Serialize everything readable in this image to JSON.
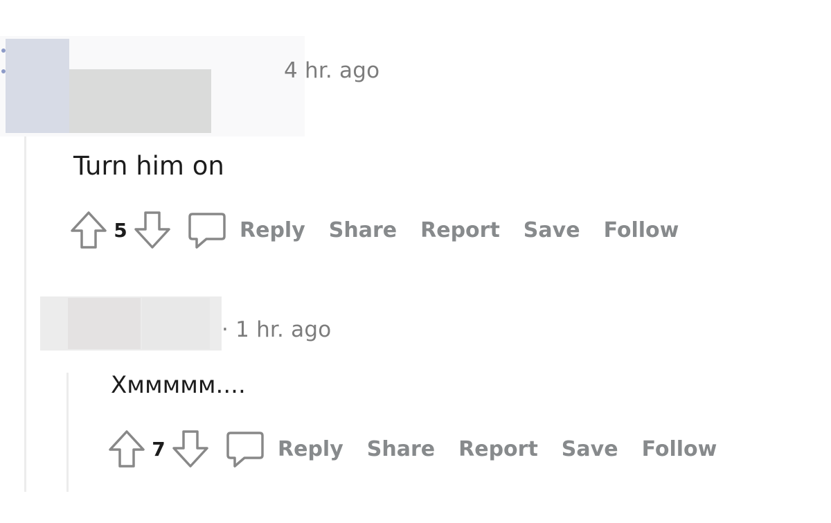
{
  "comments": [
    {
      "meta": "4 hr. ago",
      "text": "Turn him on",
      "score": "5",
      "actions": {
        "reply": "Reply",
        "share": "Share",
        "report": "Report",
        "save": "Save",
        "follow": "Follow"
      }
    },
    {
      "meta": "· 1 hr. ago",
      "text": "Хммммм....",
      "score": "7",
      "actions": {
        "reply": "Reply",
        "share": "Share",
        "report": "Report",
        "save": "Save",
        "follow": "Follow"
      }
    }
  ],
  "icons": {
    "upvote": "upvote-arrow-icon",
    "downvote": "downvote-arrow-icon",
    "comment": "speech-bubble-icon"
  },
  "colors": {
    "action_text": "#878a8c",
    "meta_text": "#7c7c7c",
    "body_text": "#1c1c1c",
    "thread_line": "#ececec"
  }
}
